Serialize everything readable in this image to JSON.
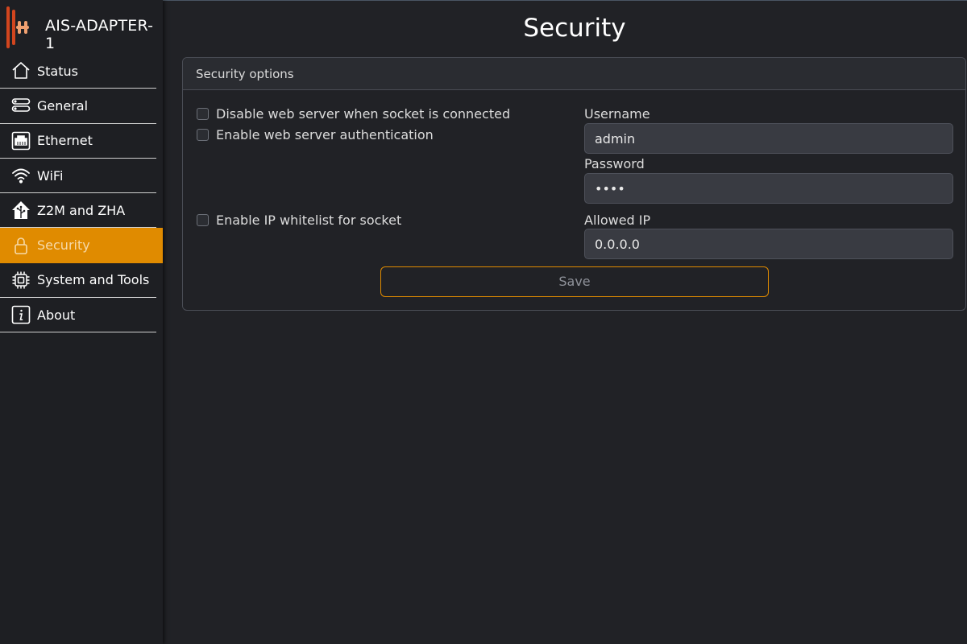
{
  "app": {
    "title": "AIS-ADAPTER-1"
  },
  "colors": {
    "accent": "#e08b00",
    "background": "#212226",
    "sidebar": "#1e1f23"
  },
  "sidebar": {
    "items": [
      {
        "label": "Status",
        "icon": "home-icon",
        "active": false
      },
      {
        "label": "General",
        "icon": "server-icon",
        "active": false
      },
      {
        "label": "Ethernet",
        "icon": "ethernet-icon",
        "active": false
      },
      {
        "label": "WiFi",
        "icon": "wifi-icon",
        "active": false
      },
      {
        "label": "Z2M and ZHA",
        "icon": "home-assistant-icon",
        "active": false
      },
      {
        "label": "Security",
        "icon": "lock-icon",
        "active": true
      },
      {
        "label": "System and Tools",
        "icon": "cpu-icon",
        "active": false
      },
      {
        "label": "About",
        "icon": "info-icon",
        "active": false
      }
    ]
  },
  "main": {
    "title": "Security",
    "card": {
      "header": "Security options",
      "options": {
        "disable_web": {
          "label": "Disable web server when socket is connected",
          "checked": false
        },
        "enable_auth": {
          "label": "Enable web server authentication",
          "checked": false
        },
        "ip_whitelist": {
          "label": "Enable IP whitelist for socket",
          "checked": false
        }
      },
      "username": {
        "label": "Username",
        "value": "admin"
      },
      "password": {
        "label": "Password",
        "value": "••••"
      },
      "allowed_ip": {
        "label": "Allowed IP",
        "value": "0.0.0.0"
      },
      "save_label": "Save"
    }
  }
}
